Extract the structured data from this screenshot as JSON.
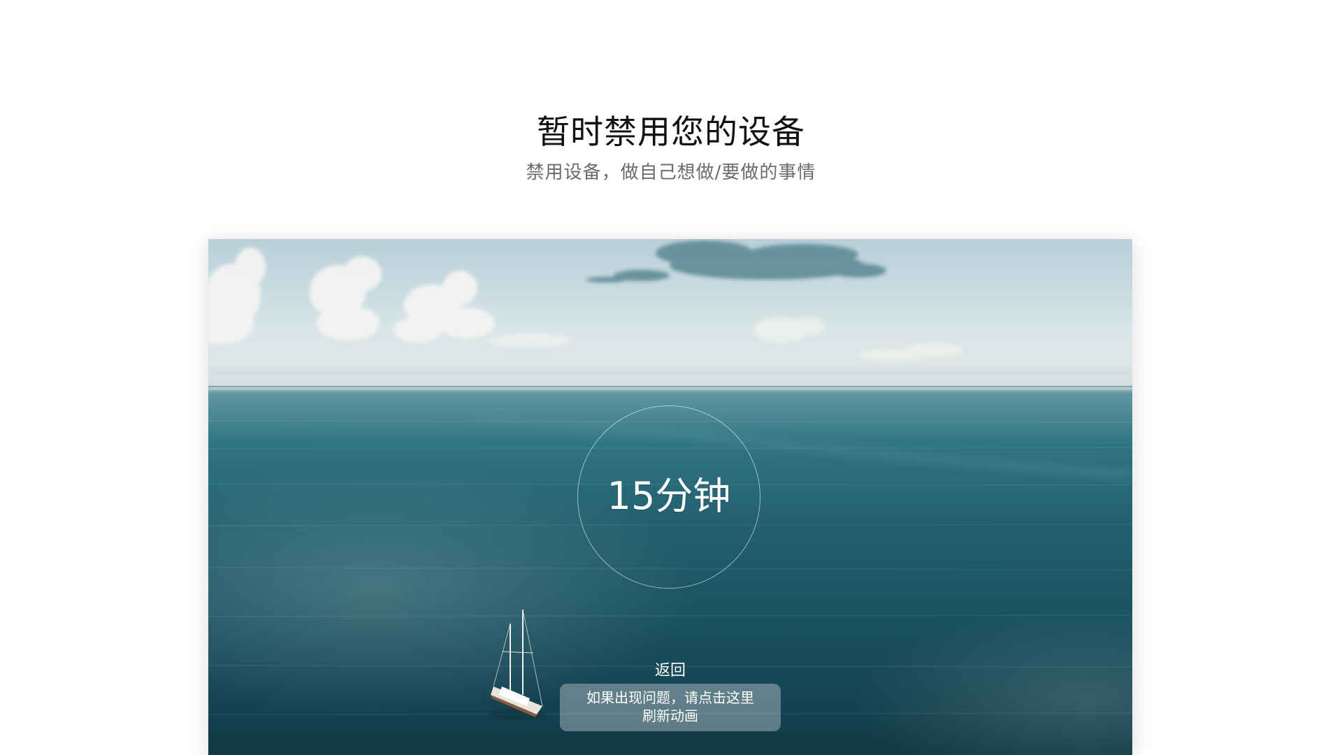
{
  "header": {
    "title": "暂时禁用您的设备",
    "subtitle": "禁用设备，做自己想做/要做的事情"
  },
  "timer": {
    "label": "15分钟"
  },
  "actions": {
    "back_label": "返回",
    "refresh_notice_line1": "如果出现问题，请点击这里",
    "refresh_notice_line2": "刷新动画"
  },
  "colors": {
    "sky": "#c8dbe1",
    "sea": "#23606f",
    "cloud_dark": "#5f8b95"
  }
}
